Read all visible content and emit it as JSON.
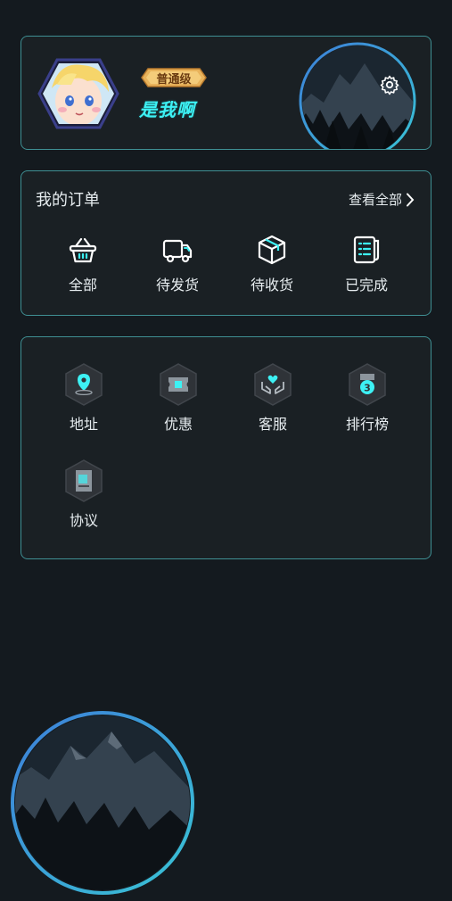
{
  "profile": {
    "level_badge": "普通级",
    "username": "是我啊",
    "icons": {
      "settings": "gear-icon",
      "avatar": "cartoon-avatar"
    }
  },
  "orders": {
    "title": "我的订单",
    "view_all": "查看全部",
    "items": [
      {
        "label": "全部",
        "icon": "basket-icon"
      },
      {
        "label": "待发货",
        "icon": "truck-icon"
      },
      {
        "label": "待收货",
        "icon": "package-icon"
      },
      {
        "label": "已完成",
        "icon": "receipt-icon"
      }
    ]
  },
  "services": {
    "items": [
      {
        "label": "地址",
        "icon": "location-icon"
      },
      {
        "label": "优惠",
        "icon": "coupon-icon"
      },
      {
        "label": "客服",
        "icon": "heart-hands-icon"
      },
      {
        "label": "排行榜",
        "icon": "ranking-medal-icon"
      },
      {
        "label": "协议",
        "icon": "document-icon"
      }
    ]
  },
  "colors": {
    "background": "#141a1f",
    "card_border": "#3f8f93",
    "accent_cyan": "#3df1f4",
    "badge_gold": "#e9b35b"
  }
}
